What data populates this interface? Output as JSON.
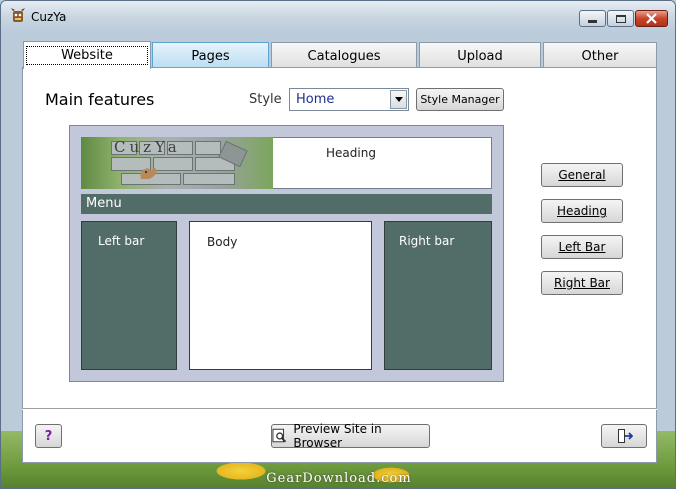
{
  "window": {
    "title": "CuzYa"
  },
  "tabs": [
    {
      "label": "Website",
      "active": true
    },
    {
      "label": "Pages",
      "active": false
    },
    {
      "label": "Catalogues",
      "active": false
    },
    {
      "label": "Upload",
      "active": false
    },
    {
      "label": "Other",
      "active": false
    }
  ],
  "main": {
    "section_title": "Main features",
    "style_label": "Style",
    "style_value": "Home",
    "style_manager_label": "Style Manager"
  },
  "preview": {
    "logo_text": "CuzYa",
    "heading_label": "Heading",
    "menu_label": "Menu",
    "left_bar_label": "Left bar",
    "body_label": "Body",
    "right_bar_label": "Right bar"
  },
  "side_buttons": {
    "general": "General",
    "heading": "Heading",
    "left_bar": "Left Bar",
    "right_bar": "Right Bar"
  },
  "footer": {
    "help_label": "?",
    "preview_label": "Preview Site in Browser"
  },
  "watermark": "GearDownload.com",
  "colors": {
    "layout_block": "#526c68",
    "preview_frame": "#c2c8da",
    "help_text": "#7b1fa2"
  }
}
